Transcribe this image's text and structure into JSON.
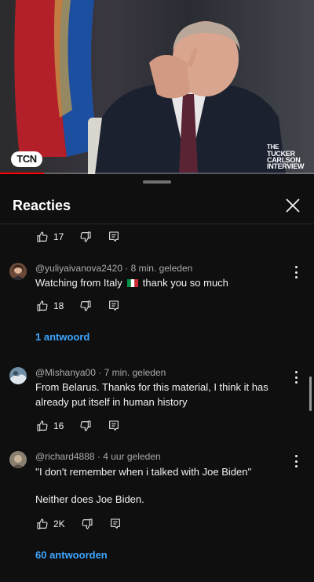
{
  "video": {
    "logo_left": "TCN",
    "logo_right": [
      "THE",
      "TUCKER",
      "CARLSON",
      "INTERVIEW"
    ],
    "progress": 0.14
  },
  "sheet": {
    "title": "Reacties"
  },
  "top_item": {
    "likes": "17"
  },
  "comments": [
    {
      "author": "@yuliyaivanova2420",
      "time": "8 min. geleden",
      "text_before_flag": "Watching from Italy",
      "text_after_flag": "thank you so much",
      "flag_icon": "italy-flag-icon",
      "likes": "18",
      "replies": "1 antwoord"
    },
    {
      "author": "@Mishanya00",
      "time": "7 min. geleden",
      "text": "From Belarus. Thanks for this material, I think it has already put itself in human history",
      "likes": "16"
    },
    {
      "author": "@richard4888",
      "time": "4 uur geleden",
      "text_line1": "''I don't remember when i talked with Joe Biden''",
      "text_line2": "Neither does Joe Biden.",
      "likes": "2K",
      "replies": "60 antwoorden"
    }
  ],
  "separator": "·",
  "colors": {
    "background": "#0f0f0f",
    "link": "#3ea6ff",
    "meta": "#aaaaaa",
    "progress": "#ff0000"
  }
}
